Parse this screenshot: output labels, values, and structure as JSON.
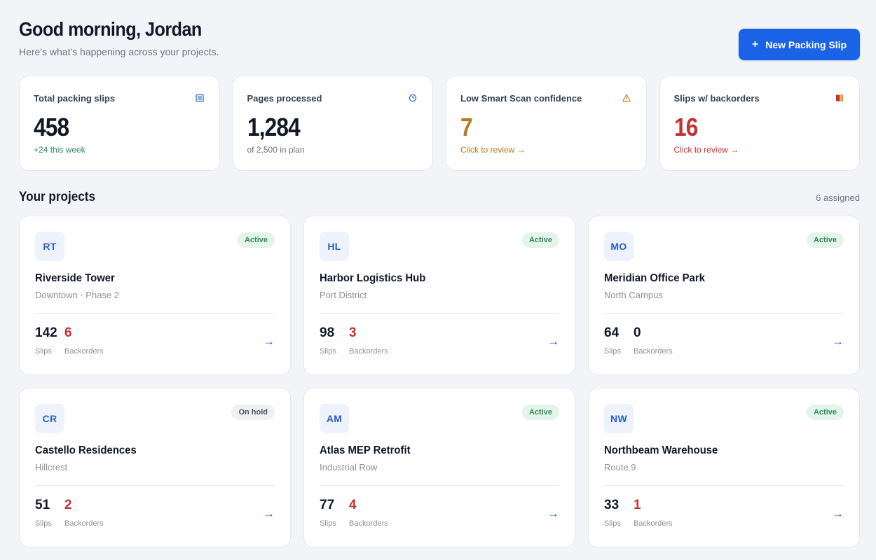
{
  "header": {
    "greeting": "Good morning, Jordan",
    "subtitle": "Here's what's happening across your projects.",
    "new_button_label": "New Packing Slip",
    "new_button_icon": "plus-icon"
  },
  "stats": [
    {
      "label": "Total packing slips",
      "icon": "document-list-icon",
      "value": "458",
      "sub": "+24 this week"
    },
    {
      "label": "Pages processed",
      "icon": "clock-icon",
      "value": "1,284",
      "sub": "of 2,500 in plan"
    },
    {
      "label": "Low Smart Scan confidence",
      "icon": "warning-icon",
      "value": "7",
      "sub": "Click to review →"
    },
    {
      "label": "Slips w/ backorders",
      "icon": "backorder-flag-icon",
      "value": "16",
      "sub": "Click to review →"
    }
  ],
  "projects_section": {
    "title": "Your projects",
    "count": "6 assigned"
  },
  "projects": [
    {
      "initials": "RT",
      "status": "Active",
      "name": "Riverside Tower",
      "location": "Downtown · Phase 2",
      "slips": "142",
      "slips_label": "Slips",
      "backorders": "6",
      "backorders_label": "Backorders"
    },
    {
      "initials": "HL",
      "status": "Active",
      "name": "Harbor Logistics Hub",
      "location": "Port District",
      "slips": "98",
      "slips_label": "Slips",
      "backorders": "3",
      "backorders_label": "Backorders"
    },
    {
      "initials": "MO",
      "status": "Active",
      "name": "Meridian Office Park",
      "location": "North Campus",
      "slips": "64",
      "slips_label": "Slips",
      "backorders": "0",
      "backorders_label": "Backorders"
    },
    {
      "initials": "CR",
      "status": "On hold",
      "name": "Castello Residences",
      "location": "Hillcrest",
      "slips": "51",
      "slips_label": "Slips",
      "backorders": "2",
      "backorders_label": "Backorders"
    },
    {
      "initials": "AM",
      "status": "Active",
      "name": "Atlas MEP Retrofit",
      "location": "Industrial Row",
      "slips": "77",
      "slips_label": "Slips",
      "backorders": "4",
      "backorders_label": "Backorders"
    },
    {
      "initials": "NW",
      "status": "Active",
      "name": "Northbeam Warehouse",
      "location": "Route 9",
      "slips": "33",
      "slips_label": "Slips",
      "backorders": "1",
      "backorders_label": "Backorders"
    }
  ],
  "arrow_glyph": "→",
  "colors": {
    "primary": "#1a62e6",
    "success": "#2f8a57",
    "warning": "#b7791f",
    "danger": "#c53030",
    "background": "#f3f4f7"
  }
}
